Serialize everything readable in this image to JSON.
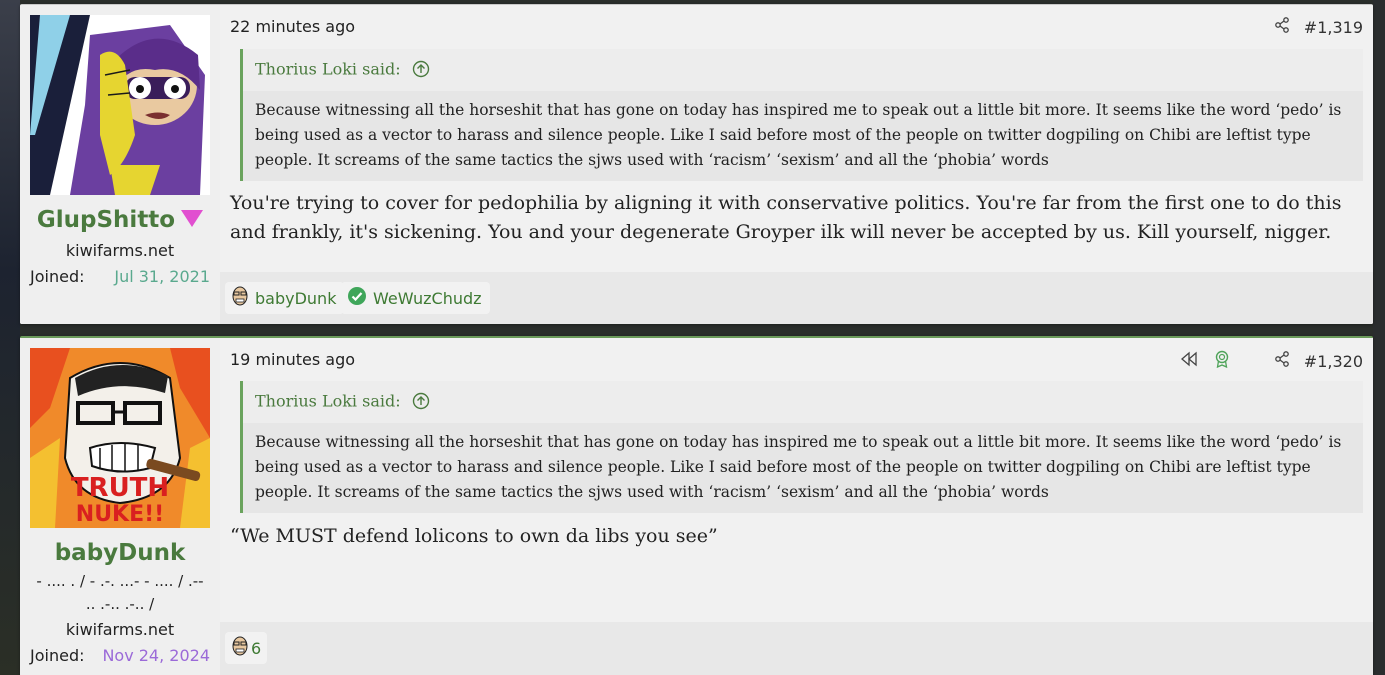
{
  "posts": [
    {
      "username": "GlupShitto",
      "user_site": "kiwifarms.net",
      "joined_label": "Joined:",
      "joined_date": "Jul 31, 2021",
      "time": "22 minutes ago",
      "post_number": "#1,319",
      "quote_author": "Thorius Loki said:",
      "quote_text": "Because witnessing all the horseshit that has gone on today has inspired me to speak out a little bit more. It seems like the word ‘pedo’ is being used as a vector to harass and silence people. Like I said before most of the people on twitter dogpiling on Chibi are leftist type people. It screams of the same tactics the sjws used with ‘racism’ ‘sexism’ and all the ‘phobia’ words",
      "body": "You're trying to cover for pedophilia by aligning it with conservative politics. You're far from the first one to do this and frankly, it's sickening. You and your degenerate Groyper ilk will never be accepted by us. Kill yourself, nigger.",
      "reactions": [
        {
          "icon": "avatar-face-icon",
          "label": "babyDunk"
        },
        {
          "icon": "checkmark-icon",
          "label": "WeWuzChudz"
        }
      ]
    },
    {
      "username": "babyDunk",
      "user_title": "- .... . / - .-. ...- - .... / .-- .. .-.. .-.. /",
      "user_site": "kiwifarms.net",
      "joined_label": "Joined:",
      "joined_date": "Nov 24, 2024",
      "time": "19 minutes ago",
      "post_number": "#1,320",
      "quote_author": "Thorius Loki said:",
      "quote_text": "Because witnessing all the horseshit that has gone on today has inspired me to speak out a little bit more. It seems like the word ‘pedo’ is being used as a vector to harass and silence people. Like I said before most of the people on twitter dogpiling on Chibi are leftist type people. It screams of the same tactics the sjws used with ‘racism’ ‘sexism’ and all the ‘phobia’ words",
      "body": "“We MUST defend lolicons to own da libs you see”",
      "avatar_text_line1": "TRUTH",
      "avatar_text_line2": "NUKE!!",
      "reaction_count": "6"
    }
  ],
  "colors": {
    "accent_green": "#4a7a3e",
    "quote_border": "#6aa35d",
    "joined_date_1": "#5aa98e",
    "joined_date_2": "#9b6ad8",
    "badge_pink": "#e14fd0"
  }
}
